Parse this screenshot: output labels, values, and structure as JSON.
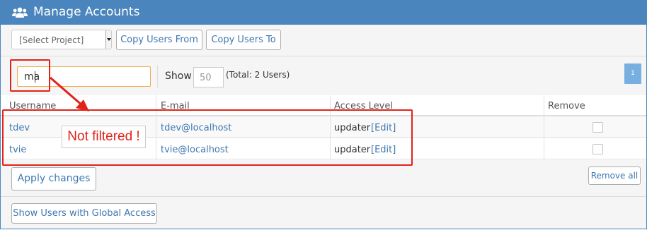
{
  "header": {
    "title": "Manage Accounts",
    "icon": "users-icon"
  },
  "toolbar": {
    "project_select": "[Select Project]",
    "copy_from_label": "Copy Users From",
    "copy_to_label": "Copy Users To"
  },
  "filter": {
    "search_value": "ma",
    "show_label": "Show",
    "show_placeholder": "50",
    "total_text": "(Total: 2 Users)",
    "page_number": "1"
  },
  "table": {
    "columns": [
      "Username",
      "E-mail",
      "Access Level",
      "Remove"
    ],
    "rows": [
      {
        "username": "tdev",
        "email": "tdev@localhost",
        "access": "updater",
        "edit": "[Edit]"
      },
      {
        "username": "tvie",
        "email": "tvie@localhost",
        "access": "updater",
        "edit": "[Edit]"
      }
    ]
  },
  "footer": {
    "apply_label": "Apply changes",
    "remove_all_label": "Remove all",
    "global_access_label": "Show Users with Global Access"
  },
  "annotation": {
    "text": "Not filtered !",
    "color": "#e2231a"
  },
  "colors": {
    "header": "#4a86bd",
    "link": "#3f78b0",
    "page_badge": "#77afe0"
  }
}
